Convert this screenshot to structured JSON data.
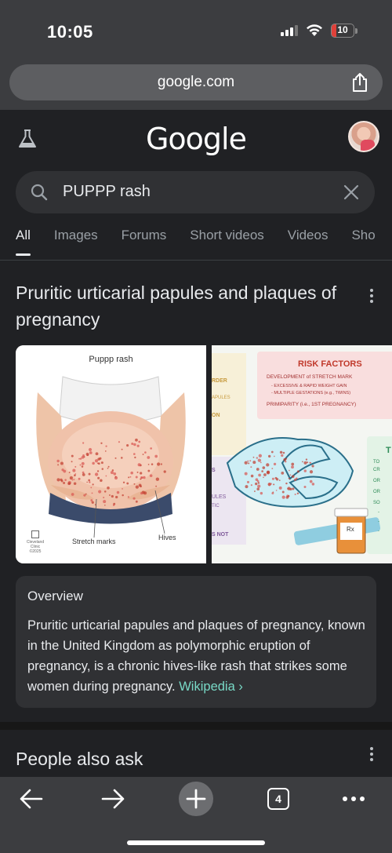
{
  "status": {
    "time": "10:05",
    "battery": "10",
    "battery_level": 0.1
  },
  "browser": {
    "url": "google.com",
    "tab_count": "4"
  },
  "google": {
    "logo": "Google"
  },
  "search": {
    "query": "PUPPP rash"
  },
  "tabs": [
    "All",
    "Images",
    "Forums",
    "Short videos",
    "Videos",
    "Sho"
  ],
  "result": {
    "title": "Pruritic urticarial papules and plaques of pregnancy",
    "image1": {
      "caption": "Puppp rash",
      "label_stretch": "Stretch marks",
      "label_hives": "Hives",
      "source": "Cleveland Clinic",
      "year": "©2025"
    },
    "image2": {
      "risk_title": "RISK FACTORS",
      "risk_items": [
        "DEVELOPMENT of STRETCH MARK",
        "- EXCESSIVE & RAPID WEIGHT GAIN",
        "- MULTIPLE GESTATIONS (e.g., TWINS)",
        "PRIMIPARITY (i.e., 1ST PREGNANCY)"
      ],
      "left_fragments": [
        "RDER",
        "APULES",
        "ON",
        "S",
        "ULES",
        "TIC",
        "S NOT"
      ],
      "right_header": "T",
      "right_fragments": [
        "TO",
        "CR",
        "OR",
        "OR",
        "SO",
        "-",
        "-",
        "-"
      ],
      "rx_label": "Rx"
    },
    "overview": {
      "heading": "Overview",
      "text": "Pruritic urticarial papules and plaques of pregnancy, known in the United Kingdom as polymorphic eruption of pregnancy, is a chronic hives-like rash that strikes some women during pregnancy.",
      "link": "Wikipedia ›"
    }
  },
  "people_also_ask": {
    "heading": "People also ask"
  },
  "icons": {
    "lab": "flask-icon",
    "search": "search-icon",
    "clear": "close-icon",
    "share": "share-icon",
    "back": "arrow-left-icon",
    "forward": "arrow-right-icon",
    "new_tab": "plus-icon",
    "menu": "more-dots-icon"
  },
  "colors": {
    "background": "#202124",
    "link": "#78d9c6",
    "battery": "#e0413a"
  }
}
